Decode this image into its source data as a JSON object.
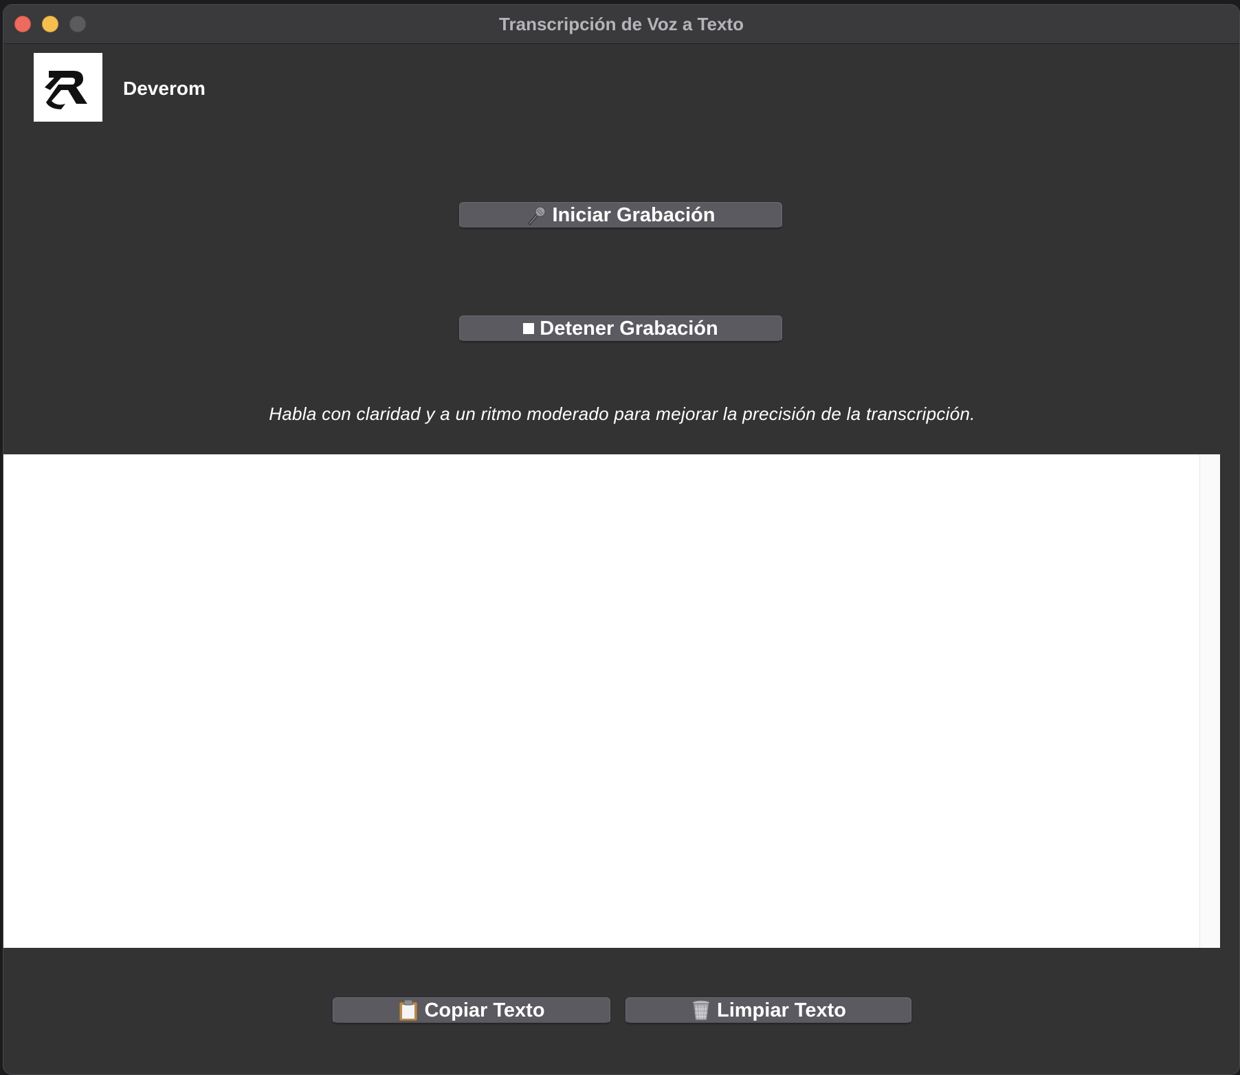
{
  "window": {
    "title": "Transcripción de Voz a Texto"
  },
  "header": {
    "brand": "Deverom"
  },
  "controls": {
    "start_label": "Iniciar Grabación",
    "start_icon": "microphone-icon",
    "stop_label": "Detener Grabación",
    "stop_icon": "stop-square-icon"
  },
  "hint": "Habla con claridad y a un ritmo moderado para mejorar la precisión de la transcripción.",
  "transcript": {
    "value": ""
  },
  "footer": {
    "copy_label": "Copiar Texto",
    "copy_icon": "clipboard-icon",
    "clear_label": "Limpiar Texto",
    "clear_icon": "trash-icon"
  },
  "colors": {
    "window_bg": "#333334",
    "button_bg": "#5b5a60",
    "close": "#ed6a5e",
    "minimize": "#f5bf4f",
    "maximize": "#5b5b5e"
  }
}
